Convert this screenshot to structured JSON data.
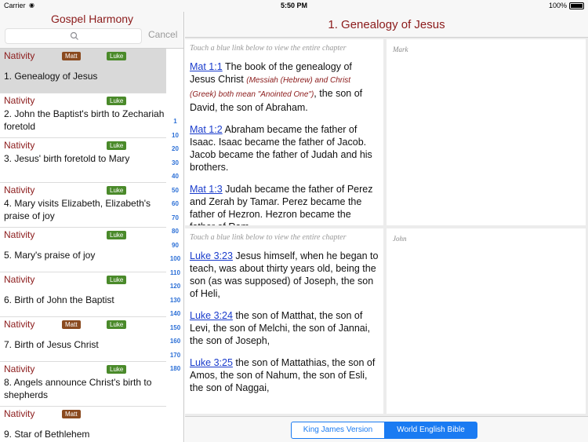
{
  "status_bar": {
    "carrier": "Carrier",
    "time": "5:50 PM",
    "battery": "100%"
  },
  "sidebar": {
    "title": "Gospel Harmony",
    "cancel_label": "Cancel",
    "items": [
      {
        "category": "Nativity",
        "matt": "Matt",
        "luke": "Luke",
        "title": "1. Genealogy of Jesus"
      },
      {
        "category": "Nativity",
        "matt": null,
        "luke": "Luke",
        "title": "2. John the Baptist's birth to Zechariah foretold"
      },
      {
        "category": "Nativity",
        "matt": null,
        "luke": "Luke",
        "title": "3. Jesus' birth foretold to Mary"
      },
      {
        "category": "Nativity",
        "matt": null,
        "luke": "Luke",
        "title": "4. Mary visits Elizabeth, Elizabeth's praise of joy"
      },
      {
        "category": "Nativity",
        "matt": null,
        "luke": "Luke",
        "title": "5. Mary's praise of joy"
      },
      {
        "category": "Nativity",
        "matt": null,
        "luke": "Luke",
        "title": "6. Birth of John the Baptist"
      },
      {
        "category": "Nativity",
        "matt": "Matt",
        "luke": "Luke",
        "title": "7. Birth of Jesus Christ"
      },
      {
        "category": "Nativity",
        "matt": null,
        "luke": "Luke",
        "title": "8. Angels announce Christ's birth to shepherds"
      },
      {
        "category": "Nativity",
        "matt": "Matt",
        "luke": null,
        "title": "9. Star of Bethlehem"
      }
    ],
    "index": [
      "1",
      "10",
      "20",
      "30",
      "40",
      "50",
      "60",
      "70",
      "80",
      "90",
      "100",
      "110",
      "120",
      "130",
      "140",
      "150",
      "160",
      "170",
      "180"
    ]
  },
  "detail": {
    "title": "1. Genealogy of Jesus",
    "hint": "Touch a blue link below to view the entire chapter",
    "mark_label": "Mark",
    "john_label": "John",
    "matthew": [
      {
        "ref": "Mat 1:1",
        "text": "The book of the genealogy of Jesus Christ",
        "note": "(Messiah (Hebrew) and Christ (Greek) both mean \"Anointed One\")",
        "text2": ", the son of David, the son of Abraham."
      },
      {
        "ref": "Mat 1:2",
        "text": "Abraham became the father of Isaac. Isaac became the father of Jacob. Jacob became the father of Judah and his brothers."
      },
      {
        "ref": "Mat 1:3",
        "text": "Judah became the father of Perez and Zerah by Tamar. Perez became the father of Hezron. Hezron became the father of Ram."
      }
    ],
    "luke": [
      {
        "ref": "Luke 3:23",
        "text": "Jesus himself, when he began to teach, was about thirty years old, being the son (as was supposed) of Joseph, the son of Heli,"
      },
      {
        "ref": "Luke 3:24",
        "text": "the son of Matthat, the son of Levi, the son of Melchi, the son of Jannai, the son of Joseph,"
      },
      {
        "ref": "Luke 3:25",
        "text": "the son of Mattathias, the son of Amos, the son of Nahum, the son of Esli, the son of Naggai,"
      }
    ],
    "version_tabs": {
      "kjv": "King James Version",
      "web": "World English Bible"
    }
  }
}
